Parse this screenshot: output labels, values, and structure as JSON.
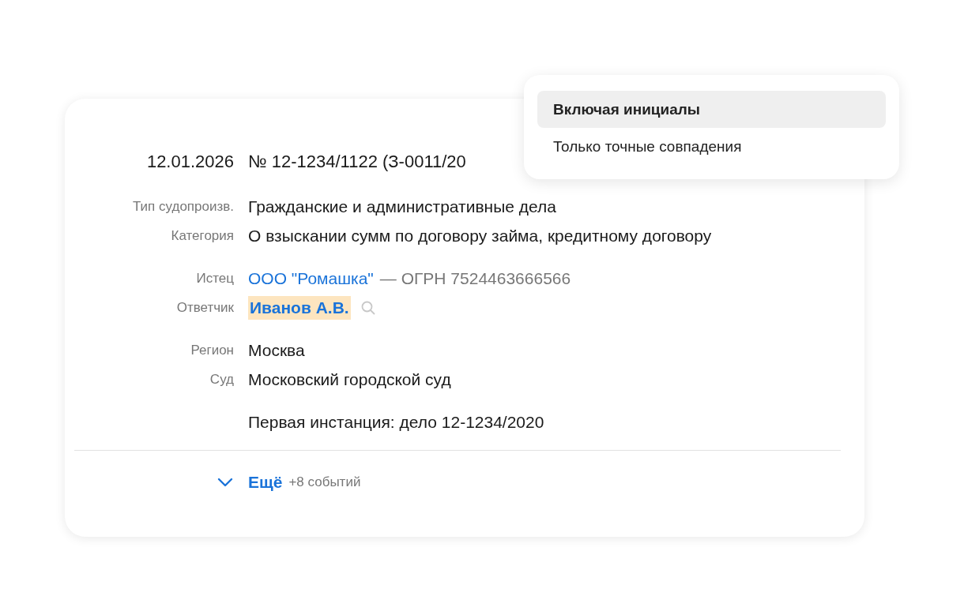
{
  "case": {
    "date": "12.01.2026",
    "number": "№ 12-1234/1122 (З-0011/20"
  },
  "groups": [
    [
      {
        "kind": "text",
        "label": "Тип судопроизв.",
        "value": "Гражданские и административные дела"
      },
      {
        "kind": "text",
        "label": "Категория",
        "value": "О взыскании сумм по договору займа, кредитному договору"
      }
    ],
    [
      {
        "kind": "party",
        "label": "Истец",
        "link": "ООО \"Ромашка\"",
        "extra": "— ОГРН 7524463666566",
        "highlighted": false
      },
      {
        "kind": "party",
        "label": "Ответчик",
        "link": "Иванов А.В.",
        "highlighted": true
      }
    ],
    [
      {
        "kind": "text",
        "label": "Регион",
        "value": "Москва"
      },
      {
        "kind": "text",
        "label": "Суд",
        "value": "Московский городской суд"
      }
    ],
    [
      {
        "kind": "note",
        "value": "Первая инстанция: дело 12-1234/2020"
      }
    ]
  ],
  "footer": {
    "more": "Ещё",
    "count": "+8 событий"
  },
  "menu": [
    {
      "label": "Включая инициалы",
      "selected": true
    },
    {
      "label": "Только точные совпадения",
      "selected": false
    }
  ]
}
